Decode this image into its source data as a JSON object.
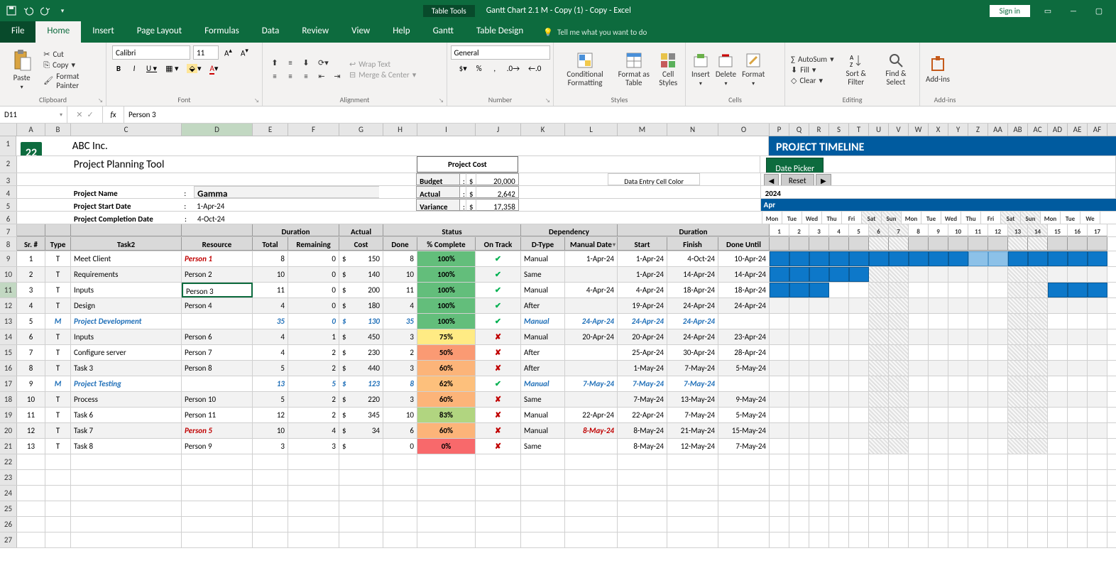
{
  "app": {
    "doc_title": "Gantt Chart 2.1 M - Copy (1) - Copy  -  Excel",
    "table_tools": "Table Tools",
    "sign_in": "Sign in"
  },
  "tabs": {
    "file": "File",
    "home": "Home",
    "insert": "Insert",
    "page_layout": "Page Layout",
    "formulas": "Formulas",
    "data": "Data",
    "review": "Review",
    "view": "View",
    "help": "Help",
    "gantt": "Gantt",
    "table_design": "Table Design",
    "tell_me": "Tell me what you want to do"
  },
  "ribbon": {
    "paste": "Paste",
    "cut": "Cut",
    "copy": "Copy",
    "format_painter": "Format Painter",
    "clipboard": "Clipboard",
    "font_family": "Calibri",
    "font_size": "11",
    "font": "Font",
    "alignment": "Alignment",
    "wrap_text": "Wrap Text",
    "merge_center": "Merge & Center",
    "number_format": "General",
    "number": "Number",
    "cond_format": "Conditional\nFormatting",
    "format_table": "Format as\nTable",
    "cell_styles": "Cell\nStyles",
    "styles": "Styles",
    "insert": "Insert",
    "delete": "Delete",
    "format": "Format",
    "cells": "Cells",
    "autosum": "AutoSum",
    "fill": "Fill",
    "clear": "Clear",
    "sort_filter": "Sort &\nFilter",
    "find_select": "Find &\nSelect",
    "editing": "Editing",
    "addins": "Add-ins"
  },
  "name_box": "D11",
  "formula": "Person 3",
  "company": "ABC Inc.",
  "tool_name": "Project Planning Tool",
  "proj_name_label": "Project Name",
  "proj_start_label": "Project Start Date",
  "proj_end_label": "Project Completion Date",
  "proj_name": "Gamma",
  "proj_start": "1-Apr-24",
  "proj_end": "4-Oct-24",
  "project_cost": {
    "title": "Project Cost",
    "budget_label": "Budget",
    "actual_label": "Actual",
    "variance_label": "Variance",
    "budget": "20,000",
    "actual": "2,642",
    "variance": "17,358"
  },
  "data_entry_label": "Data Entry Cell Color",
  "timeline": {
    "title": "PROJECT TIMELINE",
    "date_picker": "Date Picker",
    "reset": "Reset",
    "year": "2024",
    "month": "Apr",
    "days": [
      "Mon",
      "Tue",
      "Wed",
      "Thu",
      "Fri",
      "Sat",
      "Sun",
      "Mon",
      "Tue",
      "Wed",
      "Thu",
      "Fri",
      "Sat",
      "Sun",
      "Mon",
      "Tue",
      "We"
    ],
    "nums": [
      "1",
      "2",
      "3",
      "4",
      "5",
      "6",
      "7",
      "8",
      "9",
      "10",
      "11",
      "12",
      "13",
      "14",
      "15",
      "16",
      "17"
    ]
  },
  "headers": {
    "sr": "Sr. #",
    "type": "Type",
    "task": "Task2",
    "resource": "Resource",
    "duration": "Duration",
    "total": "Total",
    "remaining": "Remaining",
    "actual_cost": "Actual",
    "cost": "Cost",
    "status": "Status",
    "done": "Done",
    "pct": "% Complete",
    "on_track": "On Track",
    "dependency": "Dependency",
    "dtype": "D-Type",
    "manual_date": "Manual Date",
    "duration2": "Duration",
    "start": "Start",
    "finish": "Finish",
    "done_until": "Done Until"
  },
  "rows": [
    {
      "sr": "1",
      "type": "T",
      "task": "Meet Client",
      "resource": "Person 1",
      "res_class": "red-italic",
      "total": "8",
      "remain": "0",
      "cost": "150",
      "done": "8",
      "pct": "100%",
      "pct_class": "pct-100",
      "track": "✔",
      "track_class": "check",
      "dtype": "Manual",
      "mdate": "1-Apr-24",
      "start": "1-Apr-24",
      "finish": "4-Oct-24",
      "until": "10-Apr-24",
      "gantt": [
        0,
        16,
        0,
        10
      ]
    },
    {
      "sr": "2",
      "type": "T",
      "task": "Requirements",
      "resource": "Person 2",
      "total": "10",
      "remain": "0",
      "cost": "140",
      "done": "10",
      "pct": "100%",
      "pct_class": "pct-100",
      "track": "✔",
      "track_class": "check",
      "dtype": "Same",
      "mdate": "",
      "start": "1-Apr-24",
      "finish": "14-Apr-24",
      "until": "14-Apr-24",
      "gantt": [
        0,
        13,
        0,
        0
      ]
    },
    {
      "sr": "3",
      "type": "T",
      "task": "Inputs",
      "resource": "Person 3",
      "total": "11",
      "remain": "0",
      "cost": "200",
      "done": "11",
      "pct": "100%",
      "pct_class": "pct-100",
      "track": "✔",
      "track_class": "check",
      "dtype": "Manual",
      "mdate": "4-Apr-24",
      "start": "4-Apr-24",
      "finish": "18-Apr-24",
      "until": "18-Apr-24",
      "gantt": [
        3,
        14,
        14,
        3
      ]
    },
    {
      "sr": "4",
      "type": "T",
      "task": "Design",
      "resource": "Person 4",
      "total": "4",
      "remain": "0",
      "cost": "180",
      "done": "4",
      "pct": "100%",
      "pct_class": "pct-100",
      "track": "✔",
      "track_class": "check",
      "dtype": "After",
      "mdate": "",
      "start": "19-Apr-24",
      "finish": "24-Apr-24",
      "until": "24-Apr-24",
      "gantt": []
    },
    {
      "sr": "5",
      "type": "M",
      "type_class": "blue-italic",
      "task": "Project Development",
      "task_class": "blue-italic",
      "resource": "",
      "total": "35",
      "remain": "0",
      "cost": "130",
      "done": "35",
      "pct": "100%",
      "pct_class": "pct-100",
      "track": "✔",
      "track_class": "check",
      "dtype": "Manual",
      "dtype_class": "blue-italic",
      "mdate": "24-Apr-24",
      "mdate_class": "blue-italic",
      "start": "24-Apr-24",
      "start_class": "blue-italic",
      "finish": "24-Apr-24",
      "finish_class": "blue-italic",
      "until": "",
      "row_style": "blue-italic",
      "gantt": []
    },
    {
      "sr": "6",
      "type": "T",
      "task": "Inputs",
      "resource": "Person 6",
      "total": "4",
      "remain": "1",
      "cost": "450",
      "done": "3",
      "pct": "75%",
      "pct_class": "pct-75",
      "track": "✘",
      "track_class": "cross",
      "dtype": "Manual",
      "mdate": "20-Apr-24",
      "start": "20-Apr-24",
      "finish": "24-Apr-24",
      "until": "23-Apr-24",
      "gantt": []
    },
    {
      "sr": "7",
      "type": "T",
      "task": "Configure server",
      "resource": "Person 7",
      "total": "4",
      "remain": "2",
      "cost": "230",
      "done": "2",
      "pct": "50%",
      "pct_class": "pct-50",
      "track": "✘",
      "track_class": "cross",
      "dtype": "After",
      "mdate": "",
      "start": "25-Apr-24",
      "finish": "30-Apr-24",
      "until": "28-Apr-24",
      "gantt": []
    },
    {
      "sr": "8",
      "type": "T",
      "task": "Task 3",
      "resource": "Person 8",
      "total": "5",
      "remain": "2",
      "cost": "440",
      "done": "3",
      "pct": "60%",
      "pct_class": "pct-60",
      "track": "✘",
      "track_class": "cross",
      "dtype": "After",
      "mdate": "",
      "start": "1-May-24",
      "finish": "7-May-24",
      "until": "5-May-24",
      "gantt": []
    },
    {
      "sr": "9",
      "type": "M",
      "type_class": "blue-italic",
      "task": "Project Testing",
      "task_class": "blue-italic",
      "resource": "",
      "total": "13",
      "remain": "5",
      "cost": "123",
      "done": "8",
      "pct": "62%",
      "pct_class": "pct-62",
      "track": "✔",
      "track_class": "check",
      "dtype": "Manual",
      "dtype_class": "blue-italic",
      "mdate": "7-May-24",
      "mdate_class": "blue-italic",
      "start": "7-May-24",
      "start_class": "blue-italic",
      "finish": "7-May-24",
      "finish_class": "blue-italic",
      "until": "",
      "row_style": "blue-italic",
      "gantt": []
    },
    {
      "sr": "10",
      "type": "T",
      "task": "Process",
      "resource": "Person 10",
      "total": "5",
      "remain": "2",
      "cost": "220",
      "done": "3",
      "pct": "60%",
      "pct_class": "pct-60",
      "track": "✘",
      "track_class": "cross",
      "dtype": "Same",
      "mdate": "",
      "start": "7-May-24",
      "finish": "13-May-24",
      "until": "9-May-24",
      "gantt": []
    },
    {
      "sr": "11",
      "type": "T",
      "task": "Task 6",
      "resource": "Person 11",
      "total": "12",
      "remain": "2",
      "cost": "345",
      "done": "10",
      "pct": "83%",
      "pct_class": "pct-83",
      "track": "✘",
      "track_class": "cross",
      "dtype": "Manual",
      "mdate": "22-Apr-24",
      "start": "22-Apr-24",
      "finish": "7-May-24",
      "until": "5-May-24",
      "gantt": []
    },
    {
      "sr": "12",
      "type": "T",
      "task": "Task 7",
      "resource": "Person 5",
      "res_class": "red-italic",
      "total": "10",
      "remain": "4",
      "cost": "34",
      "done": "6",
      "pct": "60%",
      "pct_class": "pct-60",
      "track": "✘",
      "track_class": "cross",
      "dtype": "Manual",
      "mdate": "8-May-24",
      "mdate_class": "red-italic",
      "start": "8-May-24",
      "finish": "21-May-24",
      "until": "15-May-24",
      "gantt": []
    },
    {
      "sr": "13",
      "type": "T",
      "task": "Task 8",
      "resource": "Person 9",
      "total": "3",
      "remain": "3",
      "cost": "",
      "done": "0",
      "pct": "0%",
      "pct_class": "pct-0",
      "track": "✘",
      "track_class": "cross",
      "dtype": "Same",
      "mdate": "",
      "start": "8-May-24",
      "finish": "12-May-24",
      "until": "7-May-24",
      "gantt": []
    }
  ]
}
